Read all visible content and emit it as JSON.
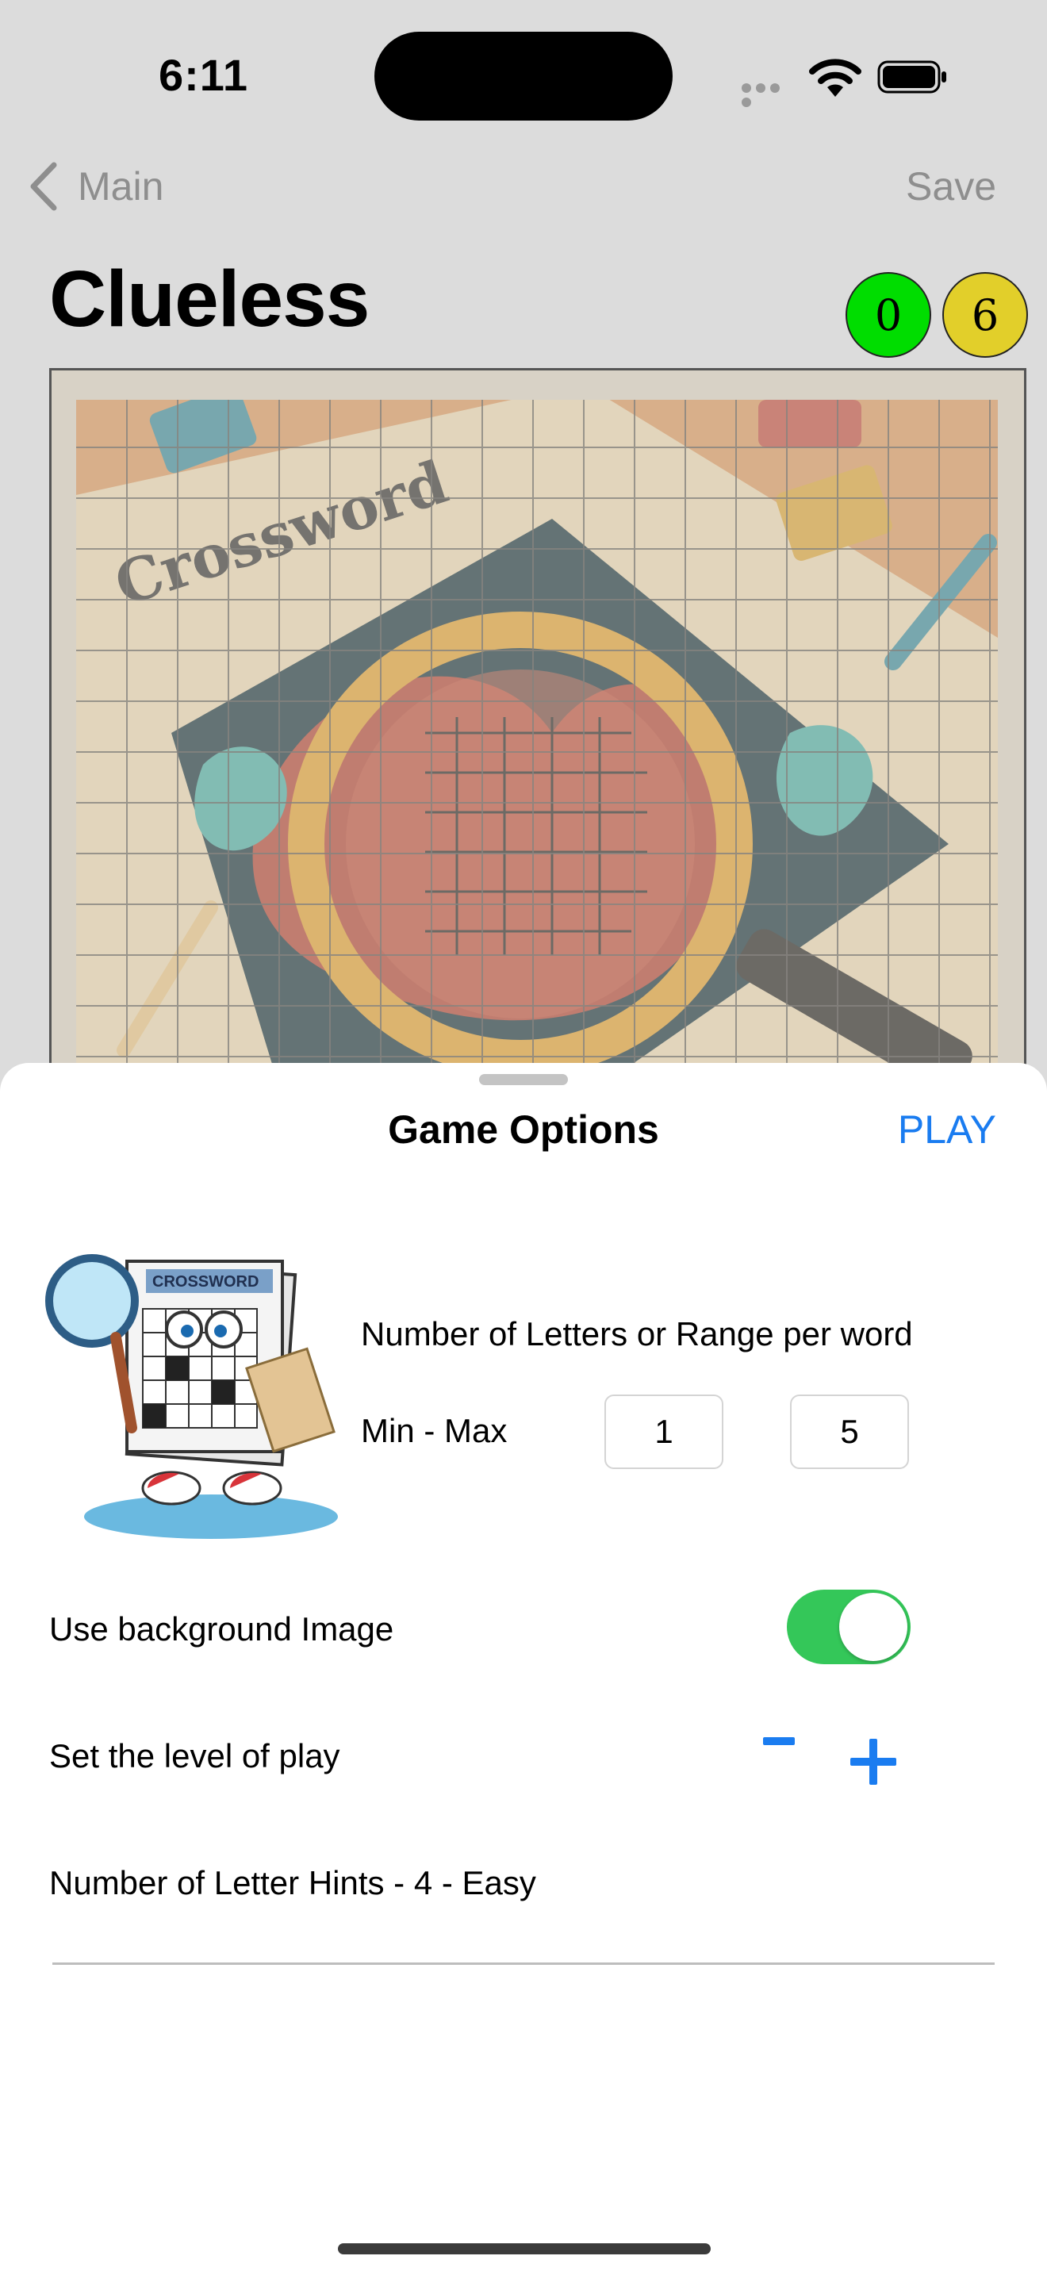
{
  "status": {
    "time": "6:11"
  },
  "nav": {
    "back_label": "Main",
    "save_label": "Save"
  },
  "page": {
    "title": "Clueless",
    "score_green": "0",
    "score_yellow": "6"
  },
  "puzzle_image": {
    "word": "Crossword"
  },
  "sheet": {
    "title": "Game Options",
    "play_label": "PLAY",
    "letters_label": "Number of Letters or Range per word",
    "minmax_label": "Min - Max",
    "min_value": "1",
    "max_value": "5",
    "background_label": "Use background Image",
    "background_enabled": true,
    "level_label": "Set the level of play",
    "minus_symbol": "-",
    "plus_symbol": "+",
    "hints_label": "Number of Letter Hints - 4 - Easy",
    "mascot_sign": "CROSSWORD"
  },
  "colors": {
    "accent": "#1a7cf0",
    "toggle_on": "#34c759",
    "badge_green": "#00dd00",
    "badge_yellow": "#e2cf2a"
  }
}
